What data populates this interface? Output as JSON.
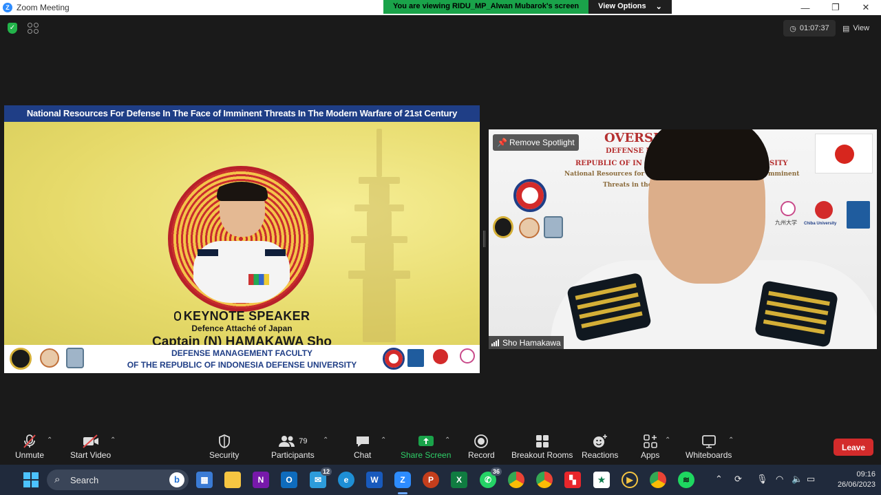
{
  "window": {
    "title": "Zoom Meeting",
    "viewing_banner": "You are viewing RIDU_MP_Alwan Mubarok's screen",
    "view_options": "View Options"
  },
  "top": {
    "timer": "01:07:37",
    "view_label": "View"
  },
  "shared_screen": {
    "header": "National Resources For Defense In The Face of Imminent Threats In The Modern Warfare of 21st Century",
    "keynote": "KEYNOTE SPEAKER",
    "role": "Defence Attaché of Japan",
    "speaker": "Captain (N) HAMAKAWA Sho",
    "footer_line1": "DEFENSE MANAGEMENT FACULTY",
    "footer_line2": "OF THE REPUBLIC OF INDONESIA DEFENSE UNIVERSITY"
  },
  "video": {
    "spotlight_button": "Remove Spotlight",
    "participant_name": "Sho Hamakawa",
    "bg_title": "OVERSE",
    "bg_line1": "DEFENSE M",
    "bg_line2": "REPUBLIC OF IN",
    "bg_line2b": "SITY",
    "bg_line3": "National Resources for D",
    "bg_line3b": "mminent",
    "bg_line4": "Threats in the",
    "bg_logo1": "九州大学",
    "bg_logo2": "Chiba University"
  },
  "toolbar": {
    "unmute": "Unmute",
    "start_video": "Start Video",
    "security": "Security",
    "participants": "Participants",
    "participant_count": "79",
    "chat": "Chat",
    "share_screen": "Share Screen",
    "record": "Record",
    "breakout_rooms": "Breakout Rooms",
    "reactions": "Reactions",
    "apps": "Apps",
    "whiteboards": "Whiteboards",
    "leave": "Leave"
  },
  "taskbar": {
    "search": "Search",
    "outlook_badge": "12",
    "whatsapp_badge": "36",
    "time": "09:16",
    "date": "26/06/2023"
  },
  "colors": {
    "share_green": "#1aa34a",
    "leave_red": "#d32b2b",
    "header_blue": "#1f3e86"
  }
}
